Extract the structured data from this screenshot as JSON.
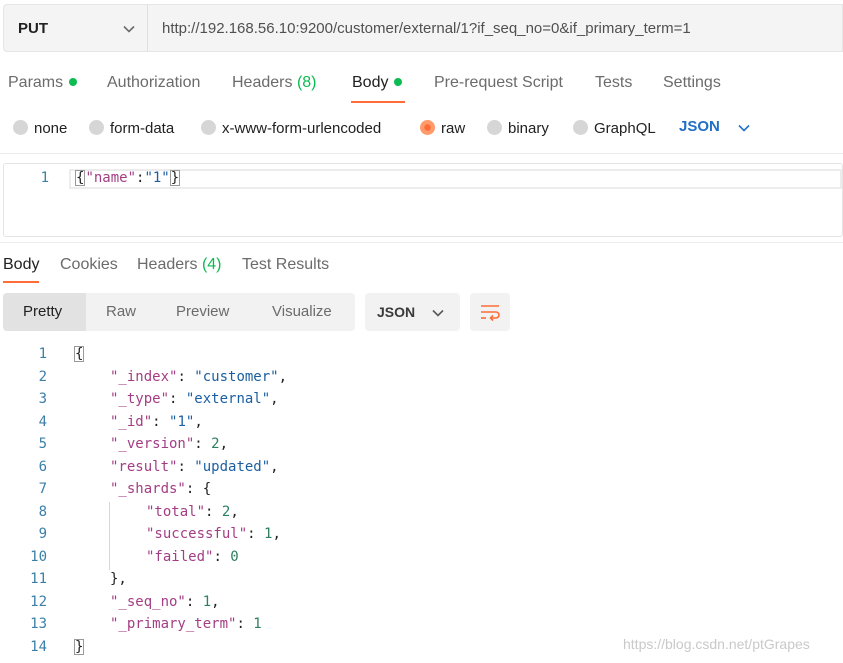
{
  "request": {
    "method": "PUT",
    "url": "http://192.168.56.10:9200/customer/external/1?if_seq_no=0&if_primary_term=1"
  },
  "request_tabs": [
    {
      "label": "Params",
      "dot": true
    },
    {
      "label": "Authorization"
    },
    {
      "label": "Headers",
      "count": "(8)"
    },
    {
      "label": "Body",
      "dot": true,
      "active": true
    },
    {
      "label": "Pre-request Script"
    },
    {
      "label": "Tests"
    },
    {
      "label": "Settings"
    }
  ],
  "body_types": [
    {
      "label": "none"
    },
    {
      "label": "form-data"
    },
    {
      "label": "x-www-form-urlencoded"
    },
    {
      "label": "raw",
      "selected": true
    },
    {
      "label": "binary"
    },
    {
      "label": "GraphQL"
    }
  ],
  "raw_language": "JSON",
  "request_body": {
    "line_number": "1",
    "key": "\"name\"",
    "colon": ":",
    "value": "\"1\""
  },
  "response_tabs": [
    {
      "label": "Body",
      "active": true
    },
    {
      "label": "Cookies"
    },
    {
      "label": "Headers",
      "count": "(4)"
    },
    {
      "label": "Test Results"
    }
  ],
  "view_modes": [
    "Pretty",
    "Raw",
    "Preview",
    "Visualize"
  ],
  "active_view_mode": "Pretty",
  "response_format": "JSON",
  "response_lines": [
    [
      {
        "t": "p",
        "v": "{"
      }
    ],
    [
      {
        "t": "k",
        "v": "\"_index\""
      },
      {
        "t": "p",
        "v": ": "
      },
      {
        "t": "s",
        "v": "\"customer\""
      },
      {
        "t": "p",
        "v": ","
      }
    ],
    [
      {
        "t": "k",
        "v": "\"_type\""
      },
      {
        "t": "p",
        "v": ": "
      },
      {
        "t": "s",
        "v": "\"external\""
      },
      {
        "t": "p",
        "v": ","
      }
    ],
    [
      {
        "t": "k",
        "v": "\"_id\""
      },
      {
        "t": "p",
        "v": ": "
      },
      {
        "t": "s",
        "v": "\"1\""
      },
      {
        "t": "p",
        "v": ","
      }
    ],
    [
      {
        "t": "k",
        "v": "\"_version\""
      },
      {
        "t": "p",
        "v": ": "
      },
      {
        "t": "n",
        "v": "2"
      },
      {
        "t": "p",
        "v": ","
      }
    ],
    [
      {
        "t": "k",
        "v": "\"result\""
      },
      {
        "t": "p",
        "v": ": "
      },
      {
        "t": "s",
        "v": "\"updated\""
      },
      {
        "t": "p",
        "v": ","
      }
    ],
    [
      {
        "t": "k",
        "v": "\"_shards\""
      },
      {
        "t": "p",
        "v": ": {"
      }
    ],
    [
      {
        "t": "k",
        "v": "\"total\""
      },
      {
        "t": "p",
        "v": ": "
      },
      {
        "t": "n",
        "v": "2"
      },
      {
        "t": "p",
        "v": ","
      }
    ],
    [
      {
        "t": "k",
        "v": "\"successful\""
      },
      {
        "t": "p",
        "v": ": "
      },
      {
        "t": "n",
        "v": "1"
      },
      {
        "t": "p",
        "v": ","
      }
    ],
    [
      {
        "t": "k",
        "v": "\"failed\""
      },
      {
        "t": "p",
        "v": ": "
      },
      {
        "t": "n",
        "v": "0"
      }
    ],
    [
      {
        "t": "p",
        "v": "},"
      }
    ],
    [
      {
        "t": "k",
        "v": "\"_seq_no\""
      },
      {
        "t": "p",
        "v": ": "
      },
      {
        "t": "n",
        "v": "1"
      },
      {
        "t": "p",
        "v": ","
      }
    ],
    [
      {
        "t": "k",
        "v": "\"_primary_term\""
      },
      {
        "t": "p",
        "v": ": "
      },
      {
        "t": "n",
        "v": "1"
      }
    ],
    [
      {
        "t": "p",
        "v": "}"
      }
    ]
  ],
  "watermark": "https://blog.csdn.net/ptGrapes",
  "colors": {
    "accent": "#ff6c37",
    "dot_green": "#0cbb52",
    "json_key": "#a33e84",
    "json_string": "#1c5fa0",
    "json_number": "#2d7f5e"
  }
}
